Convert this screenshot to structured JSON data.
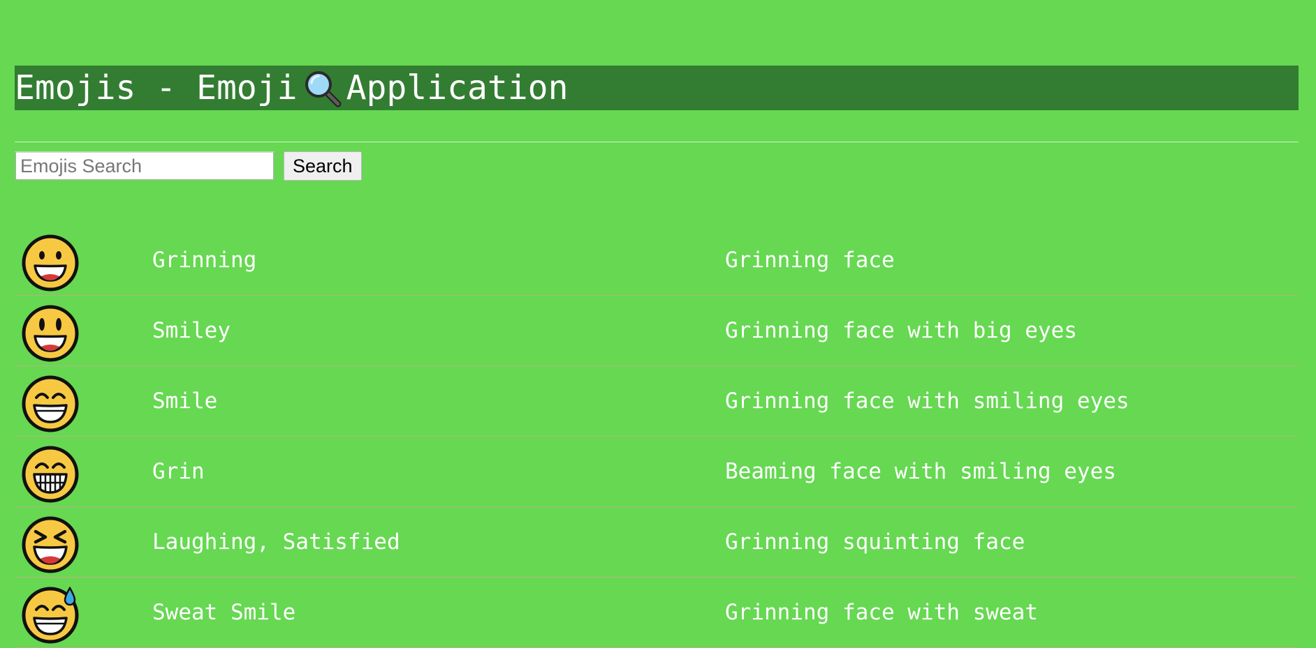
{
  "header": {
    "title_prefix": "Emojis - Emoji",
    "title_suffix": "Application",
    "title_icon": "magnifying-glass-icon"
  },
  "search": {
    "placeholder": "Emojis Search",
    "value": "",
    "button_label": "Search"
  },
  "emojis": [
    {
      "icon": "grinning-face-icon",
      "name": "Grinning",
      "description": "Grinning face"
    },
    {
      "icon": "smiley-face-icon",
      "name": "Smiley",
      "description": "Grinning face with big eyes"
    },
    {
      "icon": "smile-face-icon",
      "name": "Smile",
      "description": "Grinning face with smiling eyes"
    },
    {
      "icon": "grin-face-icon",
      "name": "Grin",
      "description": "Beaming face with smiling eyes"
    },
    {
      "icon": "laughing-face-icon",
      "name": "Laughing, Satisfied",
      "description": "Grinning squinting face"
    },
    {
      "icon": "sweat-smile-face-icon",
      "name": "Sweat Smile",
      "description": "Grinning face with sweat"
    }
  ],
  "colors": {
    "background": "#66d852",
    "title_bar": "#337d32",
    "text": "#ffffff",
    "emoji_face": "#f7c943"
  }
}
